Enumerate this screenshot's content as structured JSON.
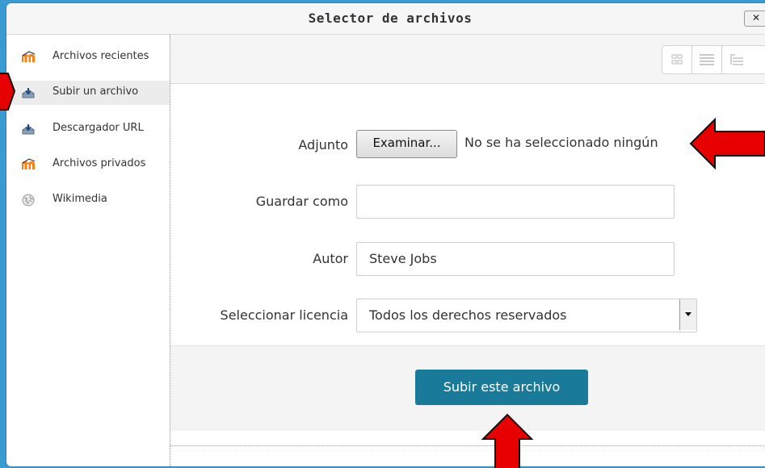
{
  "dialog": {
    "title": "Selector de archivos",
    "close_label": "✕"
  },
  "sidebar": {
    "items": [
      {
        "label": "Archivos recientes",
        "icon": "moodle-icon",
        "active": false
      },
      {
        "label": "Subir un archivo",
        "icon": "upload-icon",
        "active": true
      },
      {
        "label": "Descargador URL",
        "icon": "download-url-icon",
        "active": false
      },
      {
        "label": "Archivos privados",
        "icon": "moodle-icon",
        "active": false
      },
      {
        "label": "Wikimedia",
        "icon": "wikimedia-icon",
        "active": false
      }
    ]
  },
  "toolbar": {
    "view_icons": [
      "grid-view-icon",
      "list-view-icon",
      "tree-view-icon"
    ]
  },
  "form": {
    "attachment_label": "Adjunto",
    "browse_button": "Examinar...",
    "no_file_text": "No se ha seleccionado ningún",
    "save_as_label": "Guardar como",
    "save_as_value": "",
    "author_label": "Autor",
    "author_value": "Steve Jobs",
    "license_label": "Seleccionar licencia",
    "license_value": "Todos los derechos reservados",
    "submit_label": "Subir este archivo"
  },
  "colors": {
    "background": "#3a9bd3",
    "submit": "#1a7a9a",
    "annotation_arrow": "#e60000"
  }
}
